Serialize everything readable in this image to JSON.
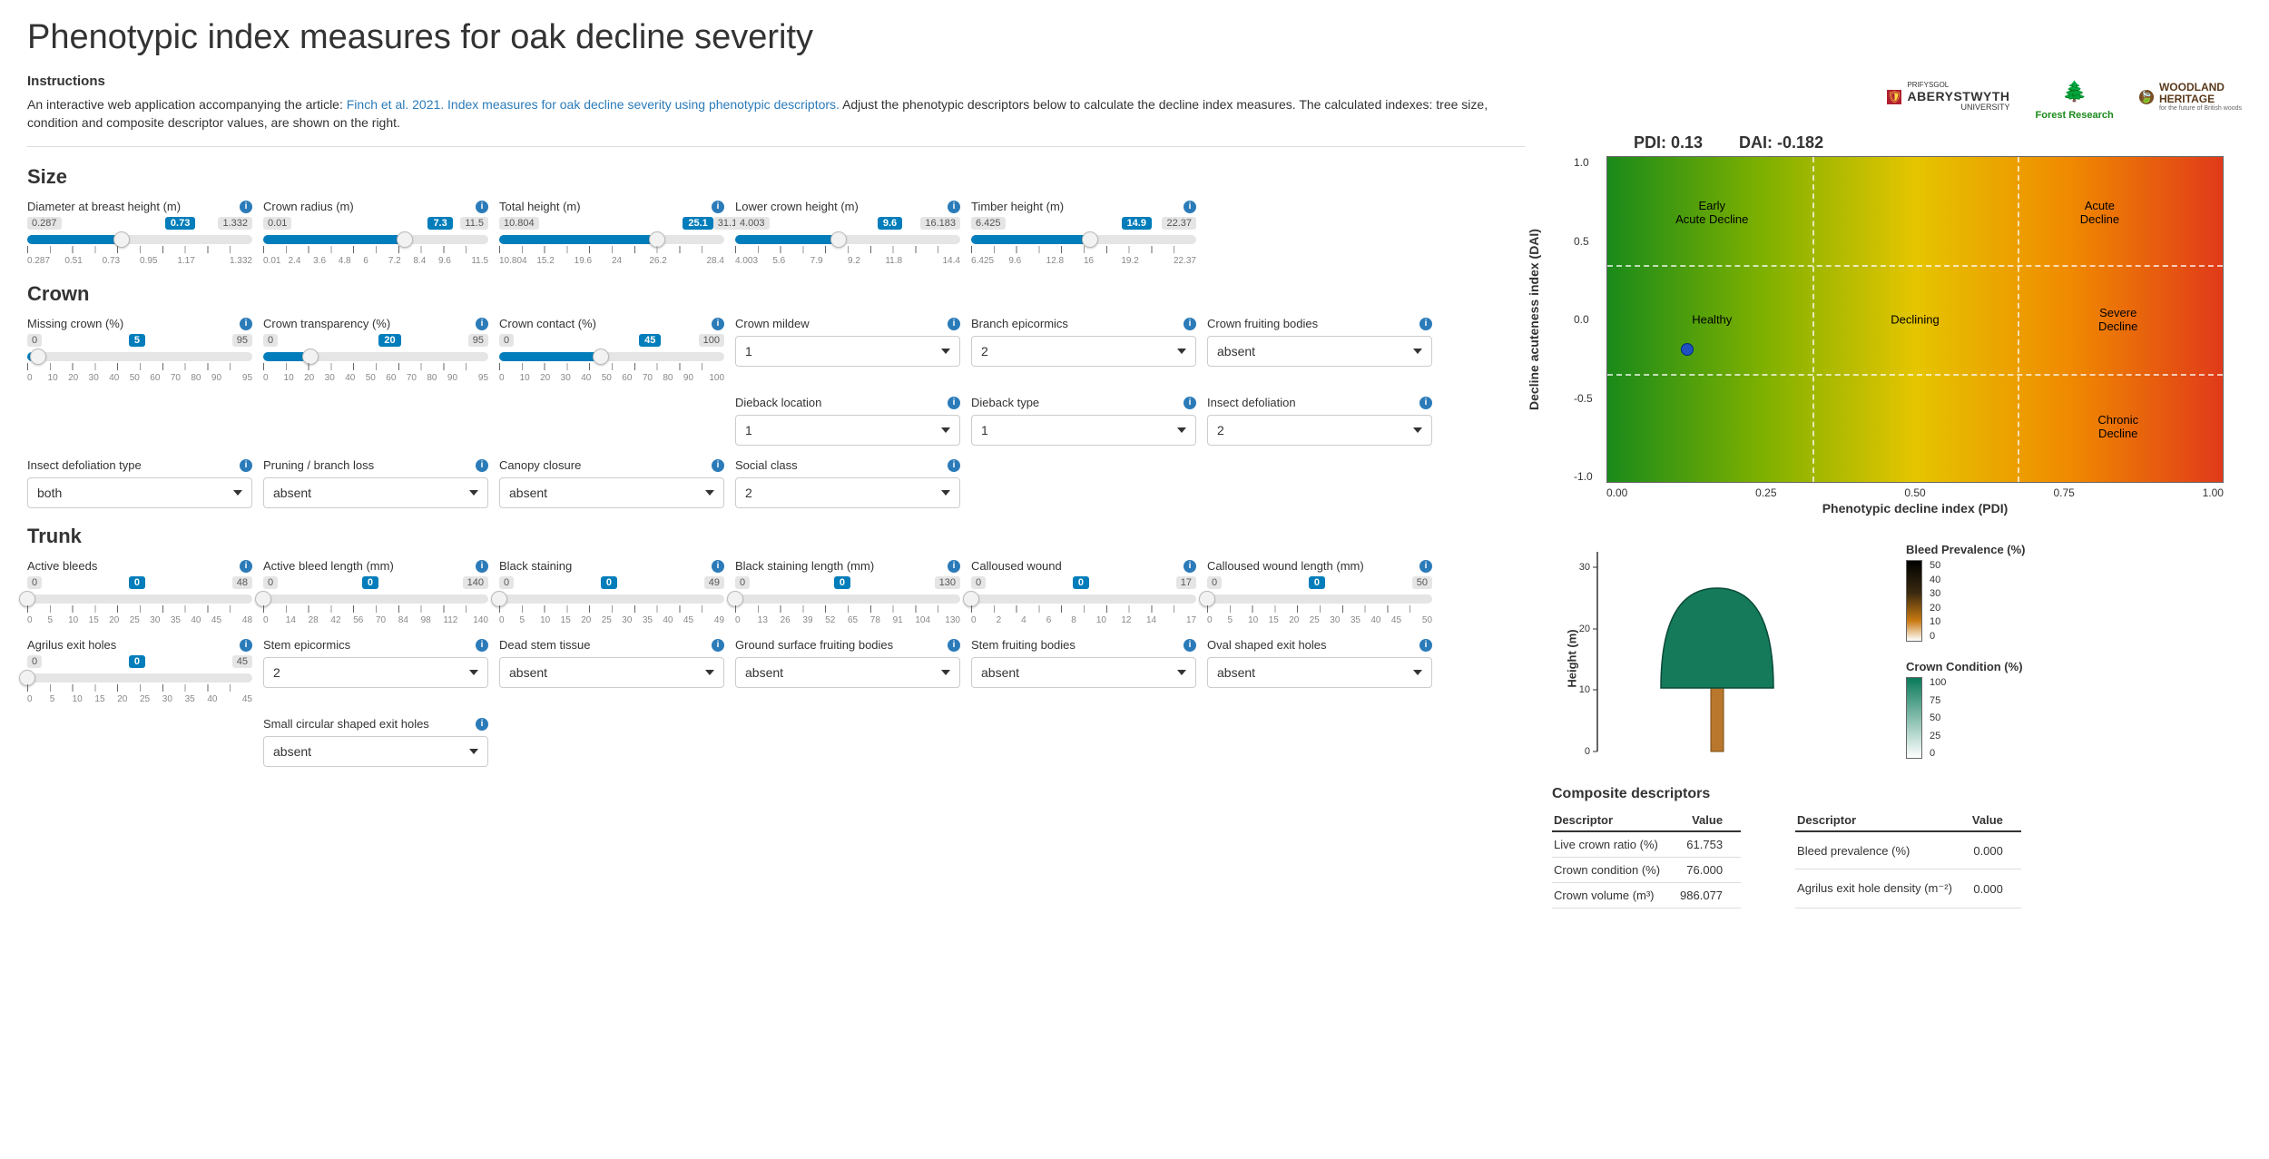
{
  "title": "Phenotypic index measures for oak decline severity",
  "instructions": {
    "heading": "Instructions",
    "prefix": "An interactive web application accompanying the article: ",
    "link": "Finch et al. 2021. Index measures for oak decline severity using phenotypic descriptors.",
    "suffix": " Adjust the phenotypic descriptors below to calculate the decline index measures. The calculated indexes: tree size, condition and composite descriptor values, are shown on the right."
  },
  "logos": {
    "aber_line1": "PRIFYSGOL",
    "aber_line2": "ABERYSTWYTH",
    "aber_line3": "UNIVERSITY",
    "forest": "Forest Research",
    "woodland_line1": "WOODLAND",
    "woodland_line2": "HERITAGE",
    "woodland_line3": "for the future of British woods"
  },
  "sections": {
    "size": "Size",
    "crown": "Crown",
    "trunk": "Trunk"
  },
  "sliders": {
    "dbh": {
      "label": "Diameter at breast height (m)",
      "min": "0.287",
      "max": "1.332",
      "value": "0.73",
      "ticks": [
        "0.287",
        "0.51",
        "0.73",
        "0.95",
        "1.17",
        "1.332"
      ],
      "pct": 42
    },
    "crad": {
      "label": "Crown radius (m)",
      "min": "0.01",
      "max": "11.5",
      "value": "7.3",
      "ticks": [
        "0.01",
        "2.4",
        "3.6",
        "4.8",
        "6",
        "7.2",
        "8.4",
        "9.6",
        "11.5"
      ],
      "pct": 63
    },
    "th": {
      "label": "Total height (m)",
      "min": "10.804",
      "max": "31.129",
      "value": "25.1",
      "ticks": [
        "10.804",
        "15.2",
        "19.6",
        "24",
        "26.2",
        "28.4"
      ],
      "pct": 70
    },
    "lch": {
      "label": "Lower crown height (m)",
      "min": "4.003",
      "max": "16.183",
      "value": "9.6",
      "ticks": [
        "4.003",
        "5.6",
        "7.9",
        "9.2",
        "11.8",
        "14.4"
      ],
      "pct": 46
    },
    "timh": {
      "label": "Timber height (m)",
      "min": "6.425",
      "max": "22.37",
      "value": "14.9",
      "ticks": [
        "6.425",
        "9.6",
        "12.8",
        "16",
        "19.2",
        "22.37"
      ],
      "pct": 53
    },
    "missc": {
      "label": "Missing crown (%)",
      "min": "0",
      "max": "95",
      "value": "5",
      "ticks": [
        "0",
        "10",
        "20",
        "30",
        "40",
        "50",
        "60",
        "70",
        "80",
        "90",
        "95"
      ],
      "pct": 5
    },
    "ctrans": {
      "label": "Crown transparency (%)",
      "min": "0",
      "max": "95",
      "value": "20",
      "ticks": [
        "0",
        "10",
        "20",
        "30",
        "40",
        "50",
        "60",
        "70",
        "80",
        "90",
        "95"
      ],
      "pct": 21
    },
    "ccont": {
      "label": "Crown contact (%)",
      "min": "0",
      "max": "100",
      "value": "45",
      "ticks": [
        "0",
        "10",
        "20",
        "30",
        "40",
        "50",
        "60",
        "70",
        "80",
        "90",
        "100"
      ],
      "pct": 45
    },
    "ableeds": {
      "label": "Active bleeds",
      "min": "0",
      "max": "48",
      "value": "0",
      "ticks": [
        "0",
        "5",
        "10",
        "15",
        "20",
        "25",
        "30",
        "35",
        "40",
        "45",
        "48"
      ],
      "pct": 0
    },
    "ablen": {
      "label": "Active bleed length (mm)",
      "min": "0",
      "max": "140",
      "value": "0",
      "ticks": [
        "0",
        "14",
        "28",
        "42",
        "56",
        "70",
        "84",
        "98",
        "112",
        "140"
      ],
      "pct": 0
    },
    "bstain": {
      "label": "Black staining",
      "min": "0",
      "max": "49",
      "value": "0",
      "ticks": [
        "0",
        "5",
        "10",
        "15",
        "20",
        "25",
        "30",
        "35",
        "40",
        "45",
        "49"
      ],
      "pct": 0
    },
    "bslen": {
      "label": "Black staining length (mm)",
      "min": "0",
      "max": "130",
      "value": "0",
      "ticks": [
        "0",
        "13",
        "26",
        "39",
        "52",
        "65",
        "78",
        "91",
        "104",
        "130"
      ],
      "pct": 0
    },
    "cwound": {
      "label": "Calloused wound",
      "min": "0",
      "max": "17",
      "value": "0",
      "ticks": [
        "0",
        "2",
        "4",
        "6",
        "8",
        "10",
        "12",
        "14",
        "17"
      ],
      "pct": 0
    },
    "cwlen": {
      "label": "Calloused wound length (mm)",
      "min": "0",
      "max": "50",
      "value": "0",
      "ticks": [
        "0",
        "5",
        "10",
        "15",
        "20",
        "25",
        "30",
        "35",
        "40",
        "45",
        "50"
      ],
      "pct": 0
    },
    "agexit": {
      "label": "Agrilus exit holes",
      "min": "0",
      "max": "45",
      "value": "0",
      "ticks": [
        "0",
        "5",
        "10",
        "15",
        "20",
        "25",
        "30",
        "35",
        "40",
        "45"
      ],
      "pct": 0
    }
  },
  "dropdowns": {
    "crown_mildew": {
      "label": "Crown mildew",
      "value": "1"
    },
    "branch_epicormics": {
      "label": "Branch epicormics",
      "value": "2"
    },
    "crown_fruiting": {
      "label": "Crown fruiting bodies",
      "value": "absent"
    },
    "dieback_location": {
      "label": "Dieback location",
      "value": "1"
    },
    "dieback_type": {
      "label": "Dieback type",
      "value": "1"
    },
    "insect_defoliation": {
      "label": "Insect defoliation",
      "value": "2"
    },
    "insect_defoliation_type": {
      "label": "Insect defoliation type",
      "value": "both"
    },
    "pruning": {
      "label": "Pruning / branch loss",
      "value": "absent"
    },
    "canopy_closure": {
      "label": "Canopy closure",
      "value": "absent"
    },
    "social_class": {
      "label": "Social class",
      "value": "2"
    },
    "stem_epicormics": {
      "label": "Stem epicormics",
      "value": "2"
    },
    "dead_stem": {
      "label": "Dead stem tissue",
      "value": "absent"
    },
    "ground_fruiting": {
      "label": "Ground surface fruiting bodies",
      "value": "absent"
    },
    "stem_fruiting": {
      "label": "Stem fruiting bodies",
      "value": "absent"
    },
    "oval_exit": {
      "label": "Oval shaped exit holes",
      "value": "absent"
    },
    "small_circ_exit": {
      "label": "Small circular shaped exit holes",
      "value": "absent"
    }
  },
  "chart_data": {
    "type": "heatmap",
    "title": {
      "pdi": "PDI: 0.13",
      "dai": "DAI: -0.182"
    },
    "xlabel": "Phenotypic decline index (PDI)",
    "ylabel": "Decline acuteness index (DAI)",
    "xlim": [
      0.0,
      1.0
    ],
    "ylim": [
      -1.0,
      1.0
    ],
    "xticks": [
      "0.00",
      "0.25",
      "0.50",
      "0.75",
      "1.00"
    ],
    "yticks": [
      "1.0",
      "0.5",
      "0.0",
      "-0.5",
      "-1.0"
    ],
    "grid_v": [
      0.333,
      0.666
    ],
    "grid_h": [
      -0.333,
      0.333
    ],
    "regions": [
      {
        "label": "Early\nAcute Decline",
        "x": 0.17,
        "y": 0.66
      },
      {
        "label": "Acute\nDecline",
        "x": 0.8,
        "y": 0.66
      },
      {
        "label": "Healthy",
        "x": 0.17,
        "y": 0.0
      },
      {
        "label": "Declining",
        "x": 0.5,
        "y": 0.0
      },
      {
        "label": "Severe\nDecline",
        "x": 0.83,
        "y": 0.0
      },
      {
        "label": "Chronic\nDecline",
        "x": 0.83,
        "y": -0.66
      }
    ],
    "point": {
      "pdi": 0.13,
      "dai": -0.182
    }
  },
  "tree": {
    "ylabel": "Height (m)",
    "yticks": [
      "0",
      "10",
      "20",
      "30"
    ],
    "legends": {
      "bleed": {
        "title": "Bleed Prevalence (%)",
        "ticks": [
          "50",
          "40",
          "30",
          "20",
          "10",
          "0"
        ]
      },
      "crown": {
        "title": "Crown Condition (%)",
        "ticks": [
          "100",
          "75",
          "50",
          "25",
          "0"
        ]
      }
    }
  },
  "composites": {
    "title": "Composite descriptors",
    "headers": {
      "desc": "Descriptor",
      "val": "Value"
    },
    "left": [
      {
        "desc": "Live crown ratio (%)",
        "val": "61.753"
      },
      {
        "desc": "Crown condition (%)",
        "val": "76.000"
      },
      {
        "desc": "Crown volume (m³)",
        "val": "986.077"
      }
    ],
    "right": [
      {
        "desc": "Bleed prevalence (%)",
        "val": "0.000"
      },
      {
        "desc": "Agrilus exit hole density (m⁻²)",
        "val": "0.000"
      }
    ]
  }
}
